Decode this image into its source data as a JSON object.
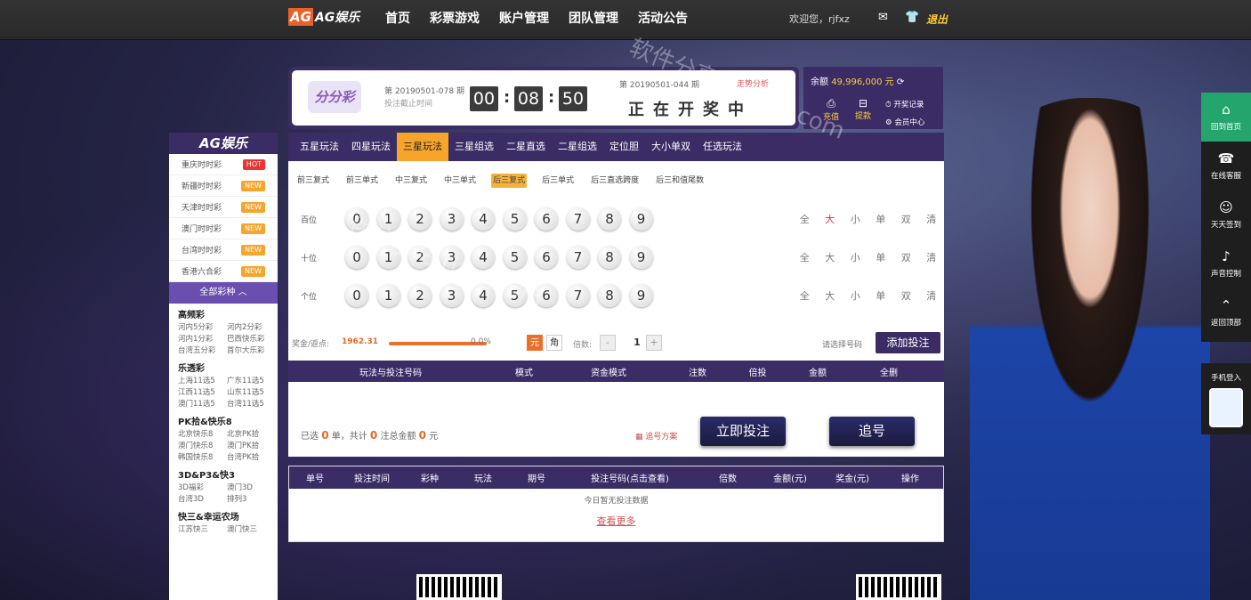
{
  "nav": {
    "logo_ag": "AG",
    "logo_text": "AG娱乐",
    "items": [
      "首页",
      "彩票游戏",
      "账户管理",
      "团队管理",
      "活动公告"
    ],
    "welcome": "欢迎您，rjfxz",
    "logout": "退出"
  },
  "sidebar": {
    "title": "AG娱乐",
    "items": [
      {
        "label": "重庆时时彩",
        "tag": "HOT"
      },
      {
        "label": "新疆时时彩",
        "tag": "NEW"
      },
      {
        "label": "天津时时彩",
        "tag": "NEW"
      },
      {
        "label": "澳门时时彩",
        "tag": "NEW"
      },
      {
        "label": "台湾时时彩",
        "tag": "NEW"
      },
      {
        "label": "香港六合彩",
        "tag": "NEW"
      }
    ],
    "all_label": "全部彩种",
    "groups": [
      {
        "title": "高频彩",
        "rows": [
          [
            "河内5分彩",
            "河内2分彩"
          ],
          [
            "河内1分彩",
            "巴西快乐彩"
          ],
          [
            "台湾五分彩",
            "首尔大乐彩"
          ]
        ]
      },
      {
        "title": "乐透彩",
        "rows": [
          [
            "上海11选5",
            "广东11选5"
          ],
          [
            "江西11选5",
            "山东11选5"
          ],
          [
            "澳门11选5",
            "台湾11选5"
          ]
        ]
      },
      {
        "title": "PK拾&快乐8",
        "rows": [
          [
            "北京快乐8",
            "北京PK拾"
          ],
          [
            "澳门快乐8",
            "澳门PK拾"
          ],
          [
            "韩国快乐8",
            "台湾PK拾"
          ]
        ]
      },
      {
        "title": "3D&P3&快3",
        "rows": [
          [
            "3D福彩",
            "澳门3D"
          ],
          [
            "台湾3D",
            "排列3"
          ]
        ]
      },
      {
        "title": "快三&幸运农场",
        "rows": [
          [
            "江苏快三",
            "澳门快三"
          ]
        ]
      }
    ]
  },
  "lottery": {
    "name": "分分彩",
    "issue": "第 20190501-078 期",
    "deadline_label": "投注截止时间",
    "countdown": [
      "00",
      "08",
      "50"
    ],
    "prev_issue": "第 20190501-044 期",
    "trend": "走势分析",
    "status": "正在开奖中"
  },
  "balance": {
    "label": "余额",
    "value": "49,996,000 元",
    "recharge": "充值",
    "withdraw": "提款",
    "records": "开奖记录",
    "help": "会员中心"
  },
  "tabs": [
    "五星玩法",
    "四星玩法",
    "三星玩法",
    "三星组选",
    "二星直选",
    "二星组选",
    "定位胆",
    "大小单双",
    "任选玩法"
  ],
  "subtabs": [
    "前三复式",
    "前三单式",
    "中三复式",
    "中三单式",
    "后三复式",
    "后三单式",
    "后三直选跨度",
    "后三和值尾数"
  ],
  "rows": [
    {
      "label": "百位"
    },
    {
      "label": "十位"
    },
    {
      "label": "个位"
    }
  ],
  "digits": [
    "0",
    "1",
    "2",
    "3",
    "4",
    "5",
    "6",
    "7",
    "8",
    "9"
  ],
  "quick": [
    "全",
    "大",
    "小",
    "单",
    "双",
    "清"
  ],
  "stake": {
    "label": "奖金/返点:",
    "value": "1962.31",
    "pct": "0.0%",
    "unit_yuan": "元",
    "unit_jiao": "角",
    "mult_label": "倍数:",
    "mult": "1",
    "picked": "请选择号码",
    "add": "添加投注"
  },
  "bet_cols": [
    "玩法与投注号码",
    "模式",
    "资金模式",
    "注数",
    "倍投",
    "金额",
    "全删"
  ],
  "summary": {
    "prefix": "已选",
    "count": "0",
    "unit": "单，共计",
    "bets": "0",
    "bets_unit": "注总金额",
    "amount": "0",
    "currency": "元",
    "chase_label": "追号方案"
  },
  "buttons": {
    "bet": "立即投注",
    "chase": "追号"
  },
  "history": {
    "cols": [
      "单号",
      "投注时间",
      "彩种",
      "玩法",
      "期号",
      "投注号码(点击查看)",
      "倍数",
      "金额(元)",
      "奖金(元)",
      "操作"
    ],
    "empty": "今日暂无投注数据",
    "more": "查看更多"
  },
  "rail": [
    "回到首页",
    "在线客服",
    "天天签到",
    "声音控制",
    "返回顶部"
  ],
  "mobile": "手机登入",
  "watermark": "软件分享站 rjfxz.com"
}
